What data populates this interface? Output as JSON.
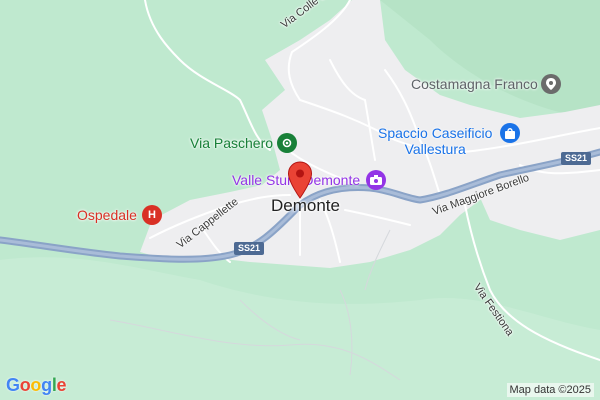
{
  "map": {
    "town_label": "Demonte",
    "road_labels": {
      "colle": "Via Colle dell'Ortica",
      "cappellette": "Via Cappellette",
      "maggiore": "Via Maggiore Borello",
      "festiona": "Via Festiona"
    },
    "route_shields": [
      "SS21",
      "SS21"
    ],
    "pois": [
      {
        "label": "Costamagna Franco",
        "icon": "map-pin-icon",
        "color": "#6b6b6b"
      },
      {
        "label": "Spaccio Caseificio\nVallestura",
        "icon": "shopping-bag-icon",
        "color": "#1a73e8"
      },
      {
        "label": "Via Paschero",
        "icon": "park-icon",
        "color": "#188038"
      },
      {
        "label": "Valle Stura Demonte",
        "icon": "camera-icon",
        "color": "#9334e6"
      },
      {
        "label": "Ospedale",
        "icon": "hospital-icon",
        "color": "#d93025"
      }
    ],
    "marker": {
      "icon": "location-pin-icon",
      "color": "#ea4335"
    },
    "logo": "Google",
    "logo_colors": [
      "#4285F4",
      "#EA4335",
      "#FBBC05",
      "#4285F4",
      "#34A853",
      "#EA4335"
    ],
    "attribution": "Map data ©2025",
    "colors": {
      "forest": "#bfe9cf",
      "town": "#eeeef0",
      "major_road": "#8aa3c7",
      "minor_road": "#ffffff"
    }
  }
}
